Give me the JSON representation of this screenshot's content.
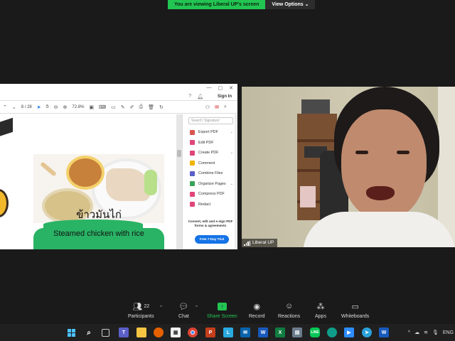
{
  "banner": {
    "viewing_text": "You are viewing Liberal UP's screen",
    "view_options": "View Options"
  },
  "acrobat": {
    "sign_in": "Sign In",
    "page_indicator": "8 / 28",
    "zoom_level": "72.8%",
    "search_placeholder": "Search 'Signature'",
    "tools": [
      {
        "label": "Export PDF",
        "color": "#d9534f",
        "chevron": true
      },
      {
        "label": "Edit PDF",
        "color": "#e0457b",
        "chevron": false
      },
      {
        "label": "Create PDF",
        "color": "#e0457b",
        "chevron": true
      },
      {
        "label": "Comment",
        "color": "#f0b400",
        "chevron": false
      },
      {
        "label": "Combine Files",
        "color": "#5b5fc7",
        "chevron": false
      },
      {
        "label": "Organize Pages",
        "color": "#3aa35b",
        "chevron": true
      },
      {
        "label": "Compress PDF",
        "color": "#e0457b",
        "chevron": false
      },
      {
        "label": "Redact",
        "color": "#e0457b",
        "chevron": false
      }
    ],
    "promo_text": "Convert, edit and e-sign PDF forms & agreements",
    "trial_button": "Free 7-Day Trial"
  },
  "document": {
    "thai_title": "ข้าวมันไก่",
    "english_title": "Steamed chicken with rice"
  },
  "webcam": {
    "participant_name": "Liberal UP"
  },
  "toolbar": {
    "participants_label": "Participants",
    "participants_count": "22",
    "chat_label": "Chat",
    "share_label": "Share Screen",
    "record_label": "Record",
    "reactions_label": "Reactions",
    "apps_label": "Apps",
    "whiteboards_label": "Whiteboards"
  },
  "taskbar": {
    "language": "ENG"
  },
  "colors": {
    "accent_green": "#23c552",
    "acrobat_blue": "#1473e6",
    "zoom_bg": "#1a1a1a"
  }
}
